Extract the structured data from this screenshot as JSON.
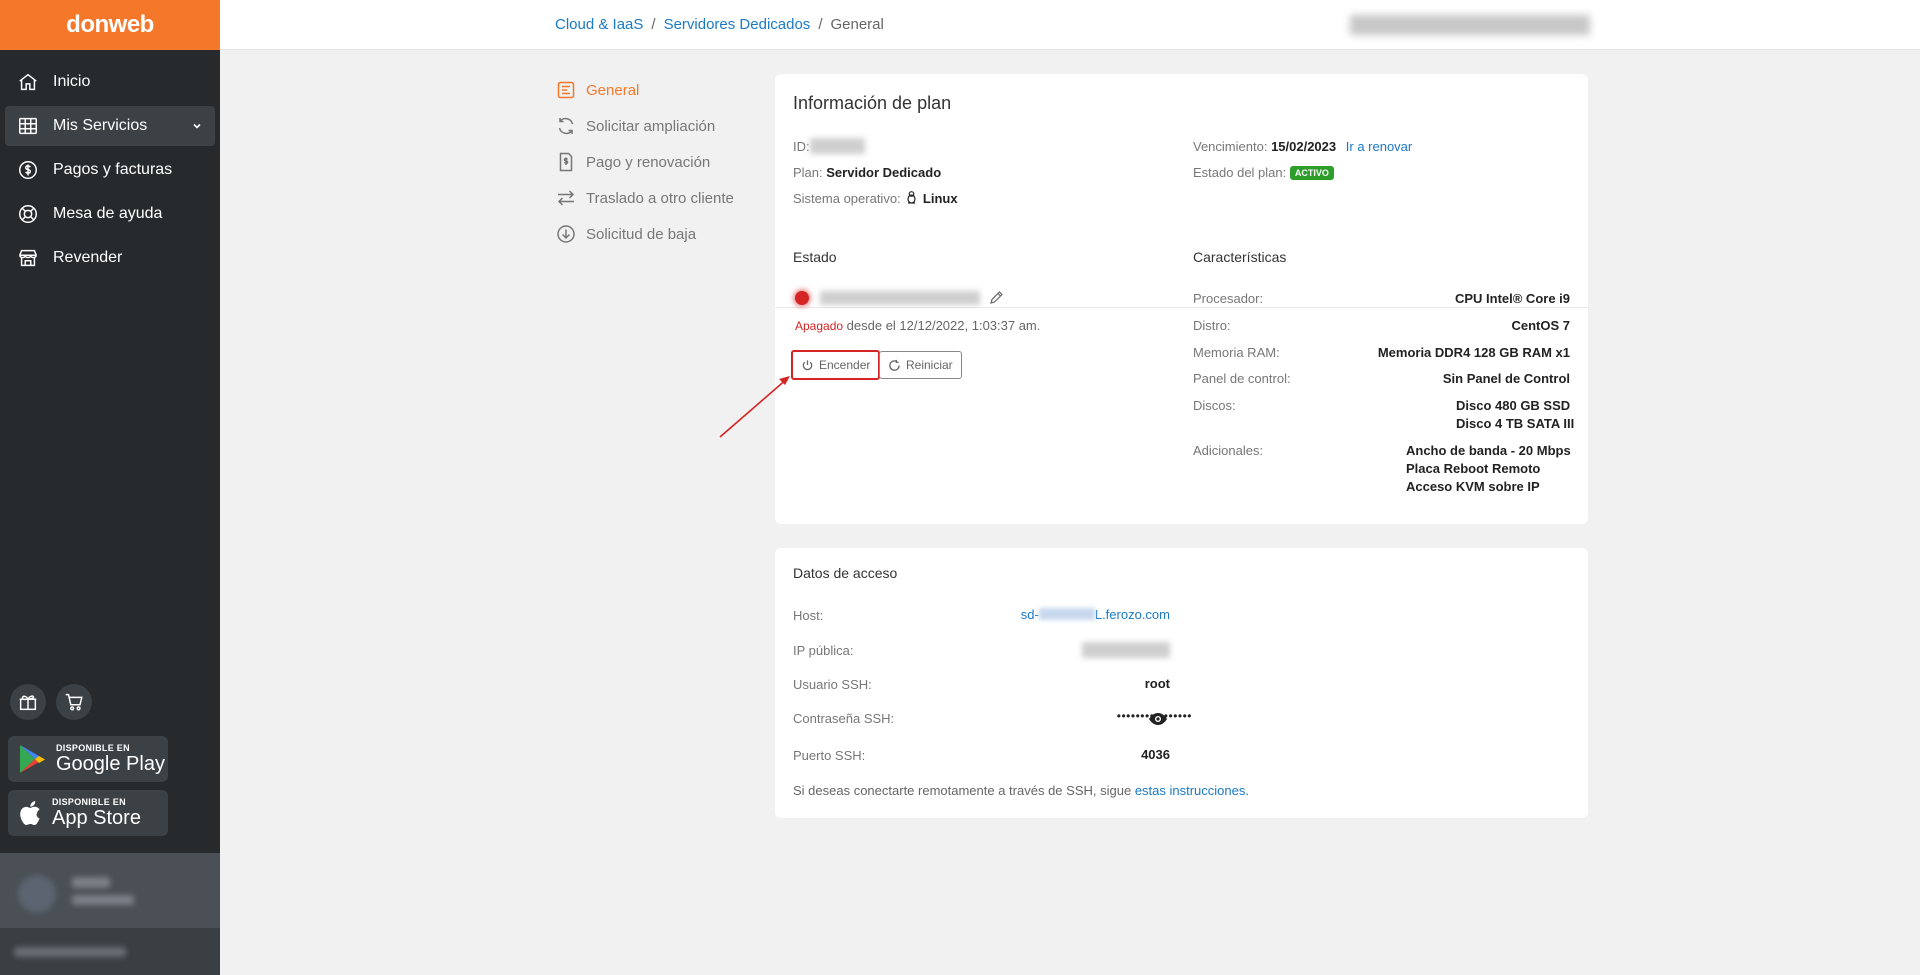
{
  "brand": {
    "name": "donweb",
    "color": "#f5782a"
  },
  "sidebar": {
    "items": [
      {
        "label": "Inicio",
        "icon": "home-icon"
      },
      {
        "label": "Mis Servicios",
        "icon": "grid-icon"
      },
      {
        "label": "Pagos y facturas",
        "icon": "dollar-icon"
      },
      {
        "label": "Mesa de ayuda",
        "icon": "lifebuoy-icon"
      },
      {
        "label": "Revender",
        "icon": "store-icon"
      }
    ],
    "google_play": {
      "small": "DISPONIBLE EN",
      "big": "Google Play"
    },
    "app_store": {
      "small": "DISPONIBLE EN",
      "big": "App Store"
    }
  },
  "breadcrumb": {
    "level1": "Cloud & IaaS",
    "level2": "Servidores Dedicados",
    "current": "General",
    "sep": "/"
  },
  "submenu": [
    {
      "label": "General",
      "icon": "document-icon"
    },
    {
      "label": "Solicitar ampliación",
      "icon": "refresh-icon"
    },
    {
      "label": "Pago y renovación",
      "icon": "invoice-icon"
    },
    {
      "label": "Traslado a otro cliente",
      "icon": "transfer-icon"
    },
    {
      "label": "Solicitud de baja",
      "icon": "download-circle-icon"
    }
  ],
  "plan": {
    "title": "Información de plan",
    "id_label": "ID:",
    "plan_label": "Plan:",
    "plan_value": "Servidor Dedicado",
    "os_label": "Sistema operativo:",
    "os_value": "Linux",
    "expiry_label": "Vencimiento:",
    "expiry_value": "15/02/2023",
    "renew_link": "Ir a renovar",
    "status_label": "Estado del plan:",
    "status_value": "ACTIVO"
  },
  "estado": {
    "title": "Estado",
    "state_word": "Apagado",
    "state_text": "desde el 12/12/2022, 1:03:37 am.",
    "power_on": "Encender",
    "restart": "Reiniciar"
  },
  "features": {
    "title": "Características",
    "processor_label": "Procesador:",
    "processor_value": "CPU Intel® Core i9",
    "distro_label": "Distro:",
    "distro_value": "CentOS 7",
    "ram_label": "Memoria RAM:",
    "ram_value": "Memoria DDR4 128 GB RAM x1",
    "panel_label": "Panel de control:",
    "panel_value": "Sin Panel de Control",
    "disks_label": "Discos:",
    "disk1": "Disco 480 GB SSD",
    "disk2": "Disco 4 TB SATA III",
    "extras_label": "Adicionales:",
    "extra1": "Ancho de banda - 20 Mbps",
    "extra2": "Placa Reboot Remoto",
    "extra3": "Acceso KVM sobre IP"
  },
  "access": {
    "title": "Datos de acceso",
    "host_label": "Host:",
    "host_prefix": "sd-",
    "host_suffix": "L.ferozo.com",
    "ip_label": "IP pública:",
    "user_label": "Usuario SSH:",
    "user_value": "root",
    "pass_label": "Contraseña SSH:",
    "pass_value": "••••••••••••••••",
    "port_label": "Puerto SSH:",
    "port_value": "4036",
    "note": "Si deseas conectarte remotamente a través de SSH, sigue",
    "note_link": "estas instrucciones."
  }
}
